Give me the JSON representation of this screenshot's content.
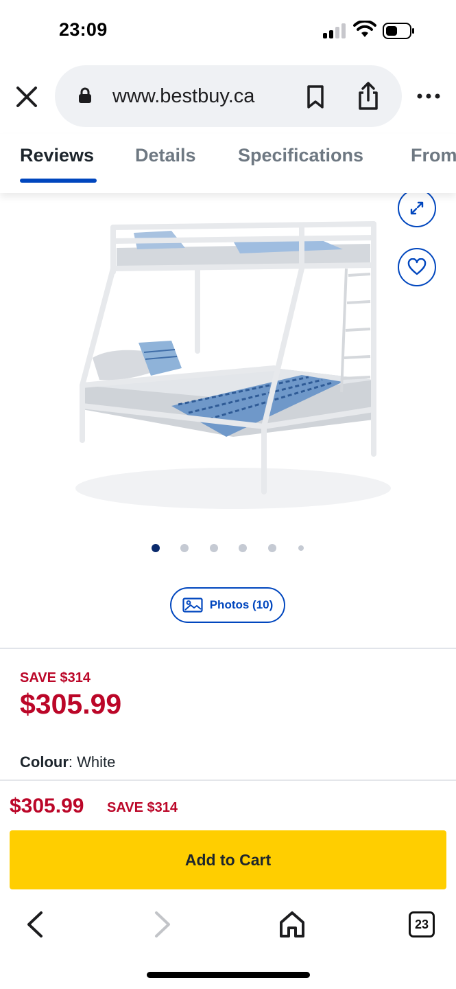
{
  "status": {
    "time": "23:09"
  },
  "browser": {
    "url": "www.bestbuy.ca"
  },
  "tabs": [
    {
      "label": "Reviews",
      "active": true
    },
    {
      "label": "Details",
      "active": false
    },
    {
      "label": "Specifications",
      "active": false
    },
    {
      "label": "From",
      "active": false
    }
  ],
  "gallery": {
    "photos_label": "Photos (10)",
    "dot_count": 6,
    "active_dot": 0
  },
  "pricing": {
    "save_label": "SAVE $314",
    "price": "$305.99"
  },
  "colour": {
    "label": "Colour",
    "value": ": White"
  },
  "sticky": {
    "price": "$305.99",
    "save_label": "SAVE $314",
    "add_to_cart_label": "Add to Cart"
  },
  "toolbar": {
    "tab_count": "23"
  },
  "colors": {
    "brand_blue": "#0046be",
    "sale_red": "#bb0628",
    "cart_yellow": "#ffce00"
  },
  "icons": [
    "close-icon",
    "lock-icon",
    "bookmark-icon",
    "share-icon",
    "more-icon",
    "expand-icon",
    "heart-icon",
    "image-icon",
    "back-icon",
    "forward-icon",
    "home-icon",
    "tabs-icon"
  ]
}
